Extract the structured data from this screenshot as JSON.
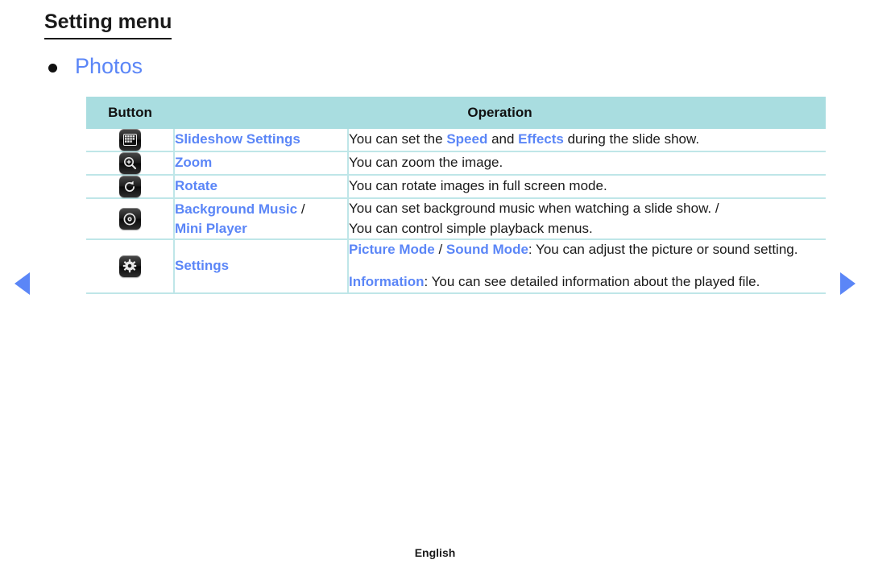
{
  "page": {
    "title": "Setting menu",
    "section_title": "Photos",
    "footer_language": "English"
  },
  "nav": {
    "prev_label": "Previous page",
    "next_label": "Next page"
  },
  "table": {
    "headers": {
      "button": "Button",
      "operation": "Operation"
    },
    "rows": [
      {
        "icon": "slideshow-settings-icon",
        "name": "Slideshow Settings",
        "operation_plain": "You can set the Speed and Effects during the slide show.",
        "op1_a": "You can set the ",
        "op1_b": "Speed",
        "op1_c": " and ",
        "op1_d": "Effects",
        "op1_e": " during the slide show."
      },
      {
        "icon": "zoom-in-icon",
        "name": "Zoom",
        "operation_plain": "You can zoom the image."
      },
      {
        "icon": "rotate-icon",
        "name": "Rotate",
        "operation_plain": "You can rotate images in full screen mode."
      },
      {
        "icon": "background-music-icon",
        "name_a": "Background Music",
        "name_sep": " /",
        "name_b": "Mini Player",
        "op_line1": "You can set background music when watching a slide show. /",
        "op_line2": "You can control simple playback menus."
      },
      {
        "icon": "settings-gear-icon",
        "name": "Settings",
        "op2_a": "Picture Mode",
        "op2_sep": " / ",
        "op2_b": "Sound Mode",
        "op2_c": ": You can adjust the picture or sound setting.",
        "op3_a": "Information",
        "op3_b": ": You can see detailed information about the played file."
      }
    ]
  },
  "colors": {
    "accent_blue": "#5b86f7",
    "header_teal": "#a9dde0",
    "border_teal": "#bfe6e8",
    "text_black": "#1a1a1a"
  }
}
